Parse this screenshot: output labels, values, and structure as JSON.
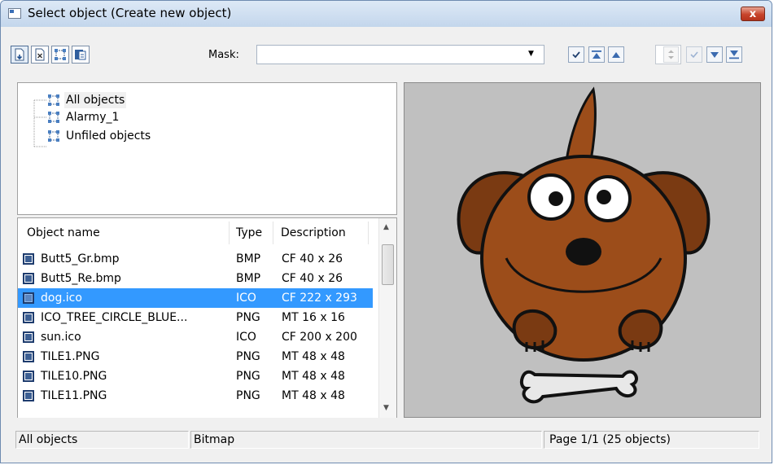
{
  "window": {
    "title": "Select object (Create new object)",
    "close_label": "x"
  },
  "toolbar": {
    "mask_label": "Mask:",
    "mask_value": ""
  },
  "tree": {
    "items": [
      {
        "label": "All objects"
      },
      {
        "label": "Alarmy_1"
      },
      {
        "label": "Unfiled objects"
      }
    ]
  },
  "list": {
    "columns": [
      "Object name",
      "Type",
      "Description"
    ],
    "rows": [
      {
        "name": "Butt5_Gr.bmp",
        "type": "BMP",
        "desc": "CF 40 x 26"
      },
      {
        "name": "Butt5_Re.bmp",
        "type": "BMP",
        "desc": "CF 40 x 26"
      },
      {
        "name": "dog.ico",
        "type": "ICO",
        "desc": "CF 222 x 293",
        "selected": true
      },
      {
        "name": "ICO_TREE_CIRCLE_BLUE...",
        "type": "PNG",
        "desc": "MT 16 x 16"
      },
      {
        "name": "sun.ico",
        "type": "ICO",
        "desc": "CF 200 x 200"
      },
      {
        "name": "TILE1.PNG",
        "type": "PNG",
        "desc": "MT 48 x 48"
      },
      {
        "name": "TILE10.PNG",
        "type": "PNG",
        "desc": "MT 48 x 48"
      },
      {
        "name": "TILE11.PNG",
        "type": "PNG",
        "desc": "MT 48 x 48"
      }
    ]
  },
  "status": {
    "folder": "All objects",
    "kind": "Bitmap",
    "page": "Page  1/1   (25 objects)"
  },
  "colors": {
    "selection": "#3399ff",
    "dog_body": "#9c4d1a",
    "preview_bg": "#c0c0c0"
  }
}
